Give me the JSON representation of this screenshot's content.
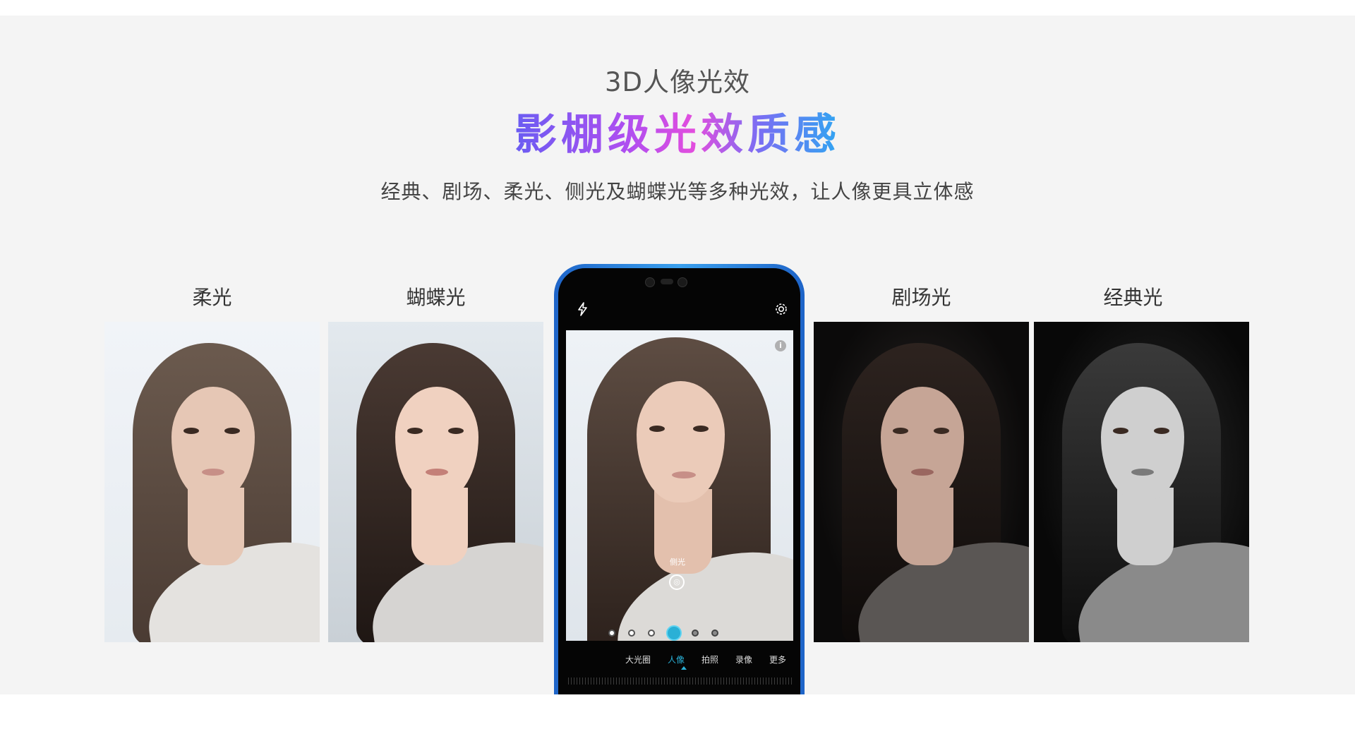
{
  "hero": {
    "eyebrow": "3D人像光效",
    "headline": "影棚级光效质感",
    "description": "经典、剧场、柔光、侧光及蝴蝶光等多种光效，让人像更具立体感"
  },
  "cards": {
    "soft": {
      "caption": "柔光"
    },
    "butterfly": {
      "caption": "蝴蝶光"
    },
    "theater": {
      "caption": "剧场光"
    },
    "classic": {
      "caption": "经典光"
    }
  },
  "phone": {
    "effect_label": "侧光",
    "info_icon": "i",
    "modes": [
      "大光圈",
      "人像",
      "拍照",
      "录像",
      "更多"
    ],
    "active_mode": "人像",
    "icons": [
      "flash-auto-icon",
      "settings-gear-icon",
      "info-icon",
      "light-effect-icon"
    ],
    "effect_slider": {
      "options": 6,
      "selected_index": 3
    }
  },
  "colors": {
    "accent": "#2ab0d6",
    "phone_frame": "#1e64c8",
    "headline_gradient": [
      "#6a5cf2",
      "#e24ede",
      "#2fa6f2"
    ]
  }
}
